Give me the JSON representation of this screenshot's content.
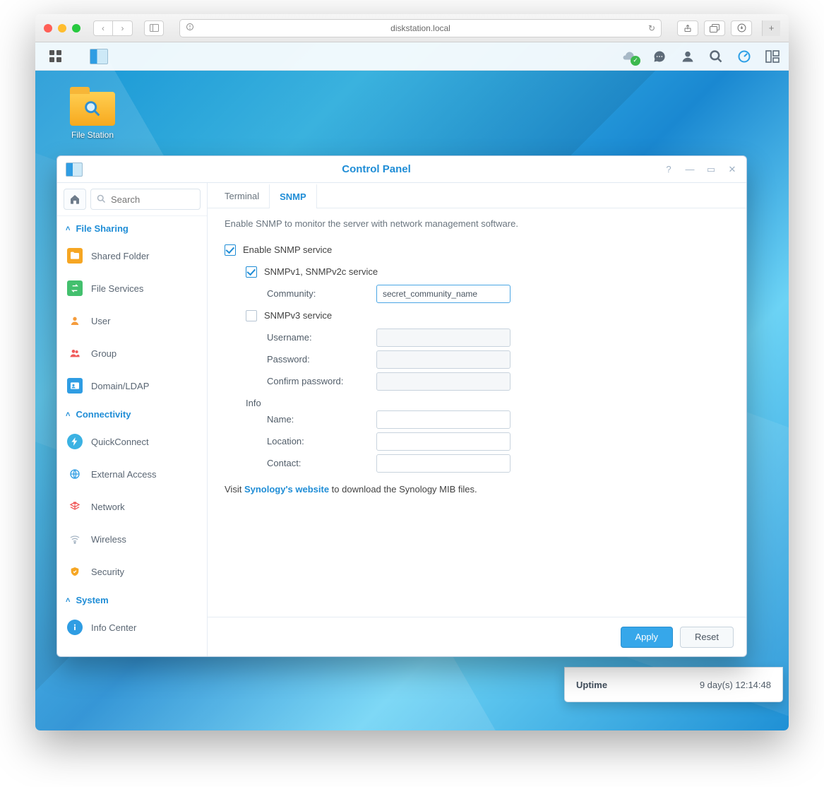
{
  "browser": {
    "url": "diskstation.local"
  },
  "desktop": {
    "fileStationLabel": "File Station"
  },
  "window": {
    "title": "Control Panel"
  },
  "sidebar": {
    "searchPlaceholder": "Search",
    "cat1": "File Sharing",
    "cat2": "Connectivity",
    "cat3": "System",
    "items": {
      "sharedFolder": "Shared Folder",
      "fileServices": "File Services",
      "user": "User",
      "group": "Group",
      "domain": "Domain/LDAP",
      "quickConnect": "QuickConnect",
      "externalAccess": "External Access",
      "network": "Network",
      "wireless": "Wireless",
      "security": "Security",
      "infoCenter": "Info Center"
    }
  },
  "tabs": {
    "terminal": "Terminal",
    "snmp": "SNMP"
  },
  "form": {
    "description": "Enable SNMP to monitor the server with network management software.",
    "enableSnmp": "Enable SNMP service",
    "v2c": "SNMPv1, SNMPv2c service",
    "communityLabel": "Community:",
    "communityValue": "secret_community_name",
    "v3": "SNMPv3 service",
    "usernameLabel": "Username:",
    "passwordLabel": "Password:",
    "confirmLabel": "Confirm password:",
    "info": "Info",
    "nameLabel": "Name:",
    "locationLabel": "Location:",
    "contactLabel": "Contact:",
    "mibPrefix": "Visit ",
    "mibLink": "Synology's website",
    "mibSuffix": " to download the Synology MIB files."
  },
  "buttons": {
    "apply": "Apply",
    "reset": "Reset"
  },
  "peek": {
    "label": "Uptime",
    "value": "9 day(s) 12:14:48"
  }
}
